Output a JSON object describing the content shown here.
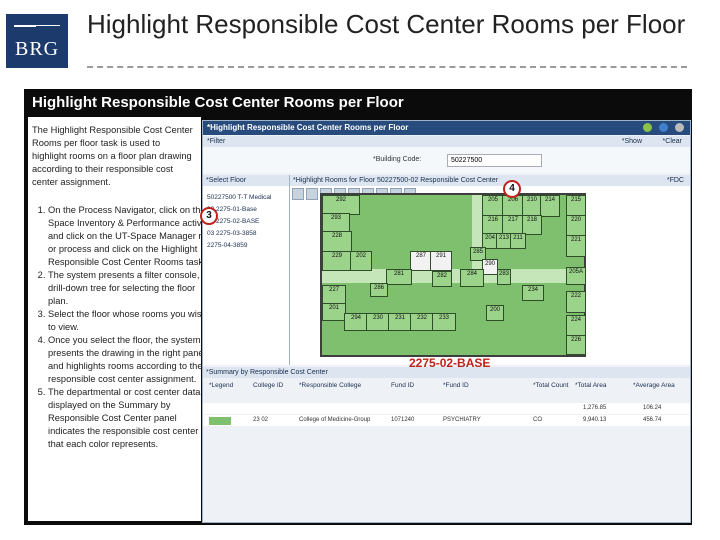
{
  "slide": {
    "logo_text": "BRG",
    "title": "Highlight Responsible Cost Center Rooms per Floor"
  },
  "panel": {
    "title": "Highlight Responsible Cost Center Rooms per Floor",
    "intro": "The Highlight Responsible Cost Center Rooms per floor task is used to highlight rooms on a floor plan drawing according to their responsible cost center assignment.",
    "steps": [
      "On the Process Navigator, click on the Space Inventory & Performance activity, and click on the UT-Space Manager role or process and click on the Highlight Responsible Cost Center Rooms task.",
      "The system presents a filter console, drill-down tree for selecting the floor plan.",
      "Select the floor whose rooms you wish to view.",
      "Once you select the floor, the system presents the drawing in the right pane and highlights rooms according to their responsible cost center assignment.",
      "The departmental or cost center data displayed on the Summary by Responsible Cost Center panel indicates the responsible cost center that each color represents."
    ]
  },
  "screenshot": {
    "window_title": "*Highlight Responsible Cost Center Rooms per Floor",
    "filter_label": "*Filter",
    "show_label": "*Show",
    "clear_label": "*Clear",
    "building_code_label": "*Building Code:",
    "building_code_value": "50227500",
    "select_floor_label": "*Select Floor",
    "tree_items": [
      "50227500 T-T Medical",
      "02 2275-01-Base",
      "03 2275-02-BASE",
      "03 2275-03-3858",
      "2275-04-3859"
    ],
    "highlight_header": "*Highlight Rooms for Floor 50227500-02 Responsible Cost Center",
    "fdc_label": "*FDC",
    "base_label": "2275-02-BASE",
    "rooms": [
      "205",
      "206",
      "210",
      "214",
      "215",
      "216",
      "217",
      "218",
      "220",
      "221",
      "222",
      "224",
      "226",
      "227",
      "228",
      "229",
      "230",
      "231",
      "232",
      "233",
      "234",
      "281",
      "282",
      "283",
      "284",
      "285",
      "286",
      "287",
      "290",
      "291",
      "292",
      "293",
      "294",
      "200",
      "201",
      "202",
      "203",
      "204",
      "205A",
      "219A",
      "209",
      "212",
      "213",
      "211",
      "223",
      "225"
    ],
    "summary_header": "*Summary by Responsible Cost Center",
    "summary_columns": [
      "*Legend",
      "College ID",
      "*Responsible College",
      "Fund ID",
      "*Fund ID",
      "*Total Count",
      "*Total Area",
      "*Average Area"
    ],
    "summary_row": [
      "",
      "23 02",
      "College of Medicine-Group",
      "1071240",
      "PSYCHIATRY",
      "CO",
      "9,940.13",
      "456.74"
    ],
    "summary_first_area": "1,276.85",
    "summary_first_avg": "106.24"
  },
  "callouts": {
    "three": "3",
    "four": "4"
  },
  "colors": {
    "panel_bg": "#0b0b0b",
    "logo_bg": "#1c3a6b",
    "plan_green": "#7fc06f",
    "accent_red": "#c0221b"
  }
}
